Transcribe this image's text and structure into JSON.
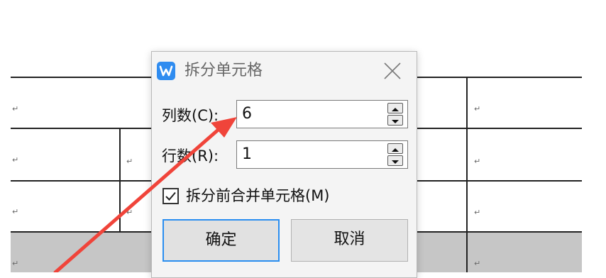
{
  "dialog": {
    "title": "拆分单元格",
    "columns_label": "列数(C):",
    "columns_value": "6",
    "rows_label": "行数(R):",
    "rows_value": "1",
    "merge_label": "拆分前合并单元格(M)",
    "merge_checked": true,
    "ok_label": "确定",
    "cancel_label": "取消"
  },
  "document": {
    "paragraph_mark": "↵"
  },
  "colors": {
    "arrow": "#f0443a",
    "focus_border": "#2a8ef0",
    "logo": "#2f8cf0",
    "table_shade": "#c6c6c6"
  }
}
